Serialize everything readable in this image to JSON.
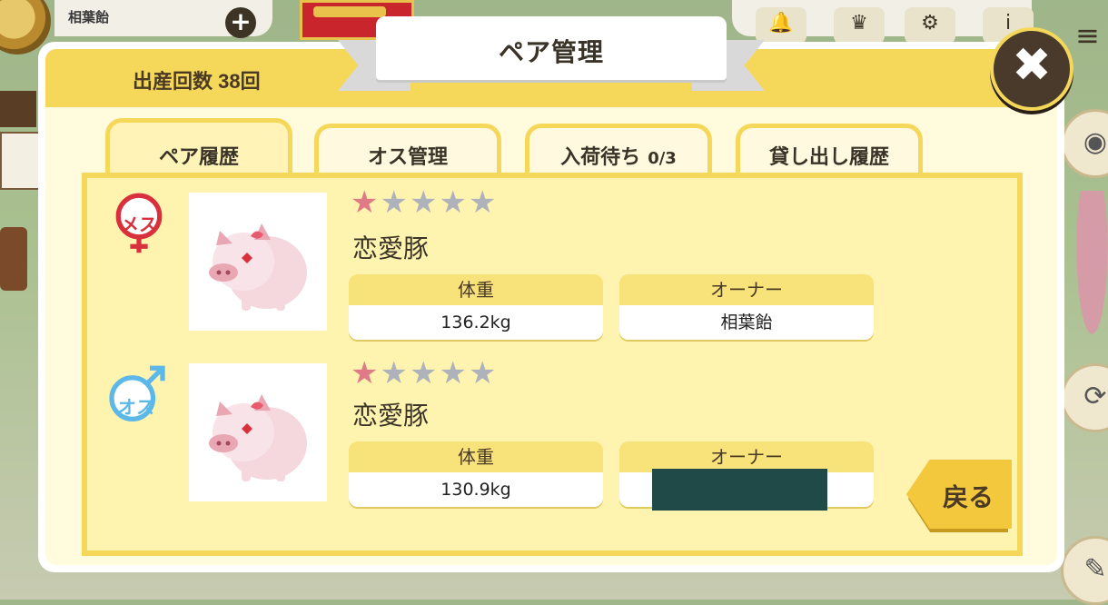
{
  "hud": {
    "player_name": "相葉飴",
    "plus_label": "+",
    "icons": [
      "bell-icon",
      "crown-icon",
      "gear-icon",
      "info-icon",
      "menu-icon"
    ]
  },
  "modal": {
    "title": "ペア管理",
    "birth_count": "出産回数 38回",
    "close_label": "✖",
    "tabs": [
      {
        "label": "ペア履歴",
        "active": true
      },
      {
        "label": "オス管理",
        "active": false
      },
      {
        "label": "入荷待ち",
        "count": "0/3",
        "active": false
      },
      {
        "label": "貸し出し履歴",
        "active": false
      }
    ],
    "pairs": [
      {
        "sex": "female",
        "sex_label": "メス",
        "rating": 1,
        "max_rating": 5,
        "name": "恋愛豚",
        "weight_label": "体重",
        "weight": "136.2kg",
        "owner_label": "オーナー",
        "owner": "相葉飴"
      },
      {
        "sex": "male",
        "sex_label": "オス",
        "rating": 1,
        "max_rating": 5,
        "name": "恋愛豚",
        "weight_label": "体重",
        "weight": "130.9kg",
        "owner_label": "オーナー",
        "owner": ""
      }
    ],
    "back_label": "戻る"
  },
  "colors": {
    "header_yellow": "#f5d75a",
    "panel_yellow": "#fff3b0",
    "female_red": "#d8303c",
    "male_blue": "#5bb8e8",
    "star_on": "#e07a86",
    "star_off": "#aeb2bb",
    "redaction": "#1f4a47"
  }
}
